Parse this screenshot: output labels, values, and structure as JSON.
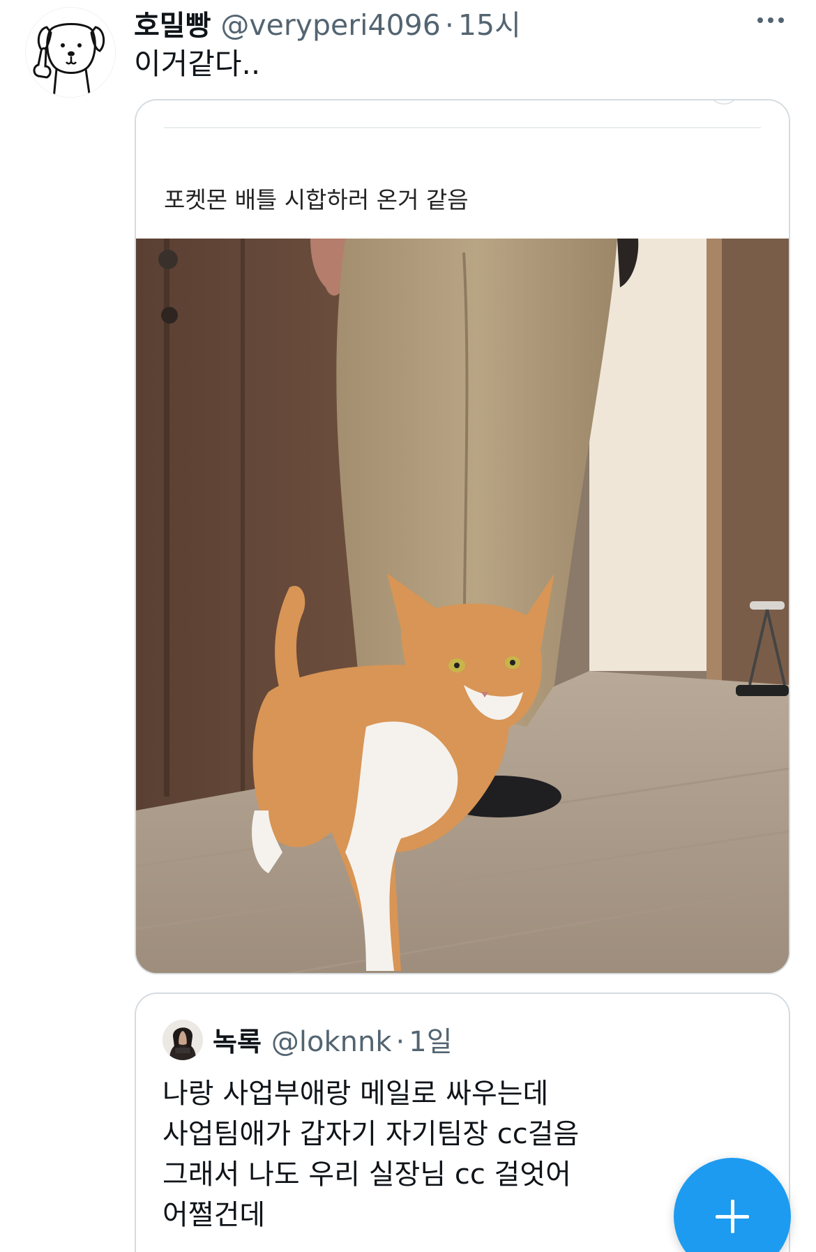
{
  "tweet": {
    "display_name": "호밀빵",
    "handle": "@veryperi4096",
    "separator": "·",
    "time": "15시",
    "text": "이거같다..",
    "avatar_icon": "dog-doodle-avatar",
    "more_icon": "more-dots-icon"
  },
  "media": {
    "caption": "포켓몬 배틀 시합하러 온거 같음",
    "photo_icon": "cat-and-legs-photo"
  },
  "quote": {
    "display_name": "녹록",
    "handle": "@loknnk",
    "separator": "·",
    "time": "1일",
    "lines": [
      "나랑 사업부애랑 메일로 싸우는데",
      "사업팀애가 갑자기 자기팀장 cc걸음",
      "그래서 나도 우리 실장님 cc 걸엇어",
      "어쩔건데"
    ]
  },
  "fab": {
    "icon": "plus-icon",
    "color": "#1d9bf0"
  }
}
